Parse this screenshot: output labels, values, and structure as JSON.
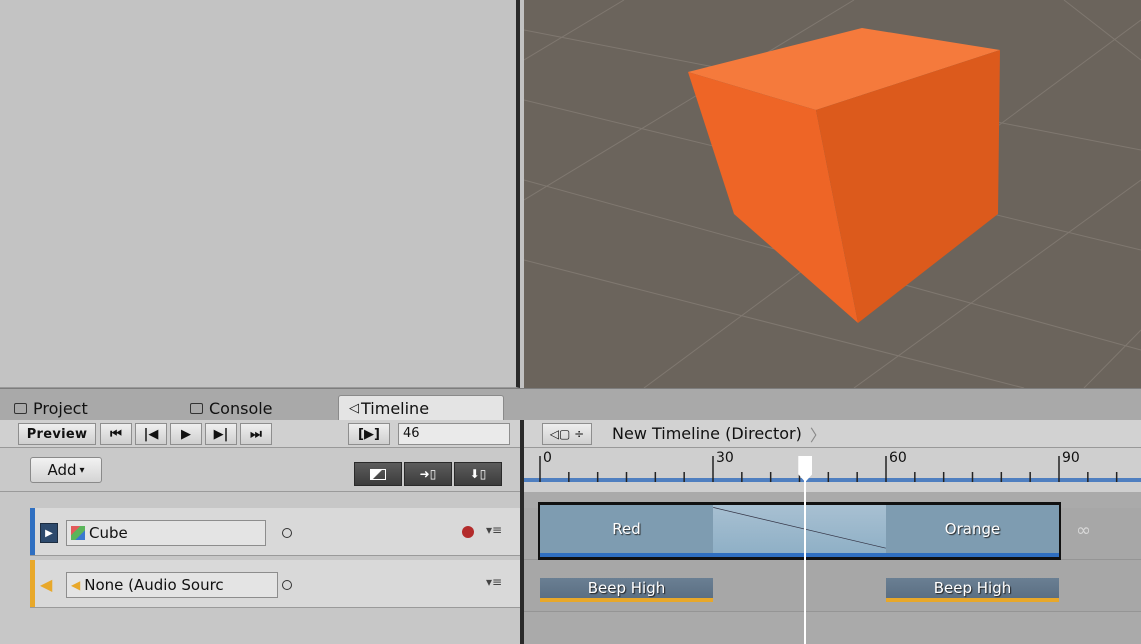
{
  "tabs": {
    "project": "Project",
    "console": "Console",
    "timeline": "Timeline"
  },
  "transport": {
    "preview_label": "Preview",
    "buttons": [
      "go-to-start",
      "previous-frame",
      "play",
      "next-frame",
      "go-to-end"
    ],
    "playrange_label": "[▶]",
    "current_frame": "46"
  },
  "toolbar": {
    "add_label": "Add"
  },
  "tracks": [
    {
      "name": "Cube",
      "type": "animation",
      "stripe_color": "#2f6fc1",
      "record_color": "#b32b2b"
    },
    {
      "name": "None (Audio Sourc",
      "type": "audio",
      "stripe_color": "#e8a82a"
    }
  ],
  "timeline": {
    "asset_name": "New Timeline (Director)",
    "ruler_labels": [
      "0",
      "30",
      "60",
      "90"
    ],
    "playhead_frame": 46,
    "animation_clips": [
      {
        "label": "Red",
        "start": 0,
        "end": 30
      },
      {
        "label": "Orange",
        "start": 60,
        "end": 90
      }
    ],
    "blend": {
      "start": 30,
      "end": 60
    },
    "audio_clips": [
      {
        "label": "Beep High",
        "start": 0,
        "end": 30
      },
      {
        "label": "Beep High",
        "start": 60,
        "end": 90
      }
    ],
    "infinity_symbol": "∞"
  },
  "colors": {
    "cube_orange": "#ef6a2c",
    "clip_blue": "#7e9cb1",
    "audio_underline": "#e8a82a",
    "anim_underline": "#2f6fc1"
  }
}
